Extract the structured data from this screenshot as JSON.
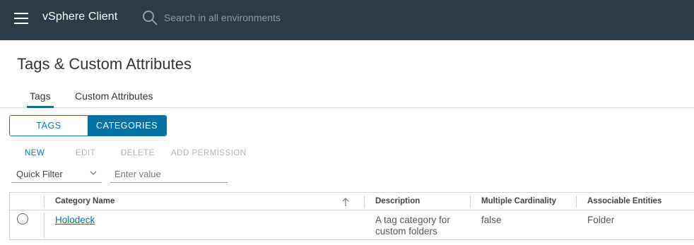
{
  "header": {
    "app_title": "vSphere Client",
    "search_placeholder": "Search in all environments"
  },
  "page": {
    "title": "Tags & Custom Attributes"
  },
  "tabs": [
    {
      "label": "Tags",
      "active": true
    },
    {
      "label": "Custom Attributes",
      "active": false
    }
  ],
  "toggle": {
    "tags_label": "TAGS",
    "categories_label": "CATEGORIES",
    "selected": "CATEGORIES"
  },
  "actions": {
    "new": "NEW",
    "edit": "EDIT",
    "delete": "DELETE",
    "add_permission": "ADD PERMISSION"
  },
  "filter": {
    "select_value": "Quick Filter",
    "input_placeholder": "Enter value"
  },
  "table": {
    "columns": [
      "Category Name",
      "Description",
      "Multiple Cardinality",
      "Associable Entities"
    ],
    "rows": [
      {
        "name": "Holodeck",
        "description": "A tag category for custom folders",
        "multiple_cardinality": "false",
        "associable_entities": "Folder"
      }
    ]
  },
  "colors": {
    "topbar": "#2b3c46",
    "accent": "#0072a3"
  }
}
